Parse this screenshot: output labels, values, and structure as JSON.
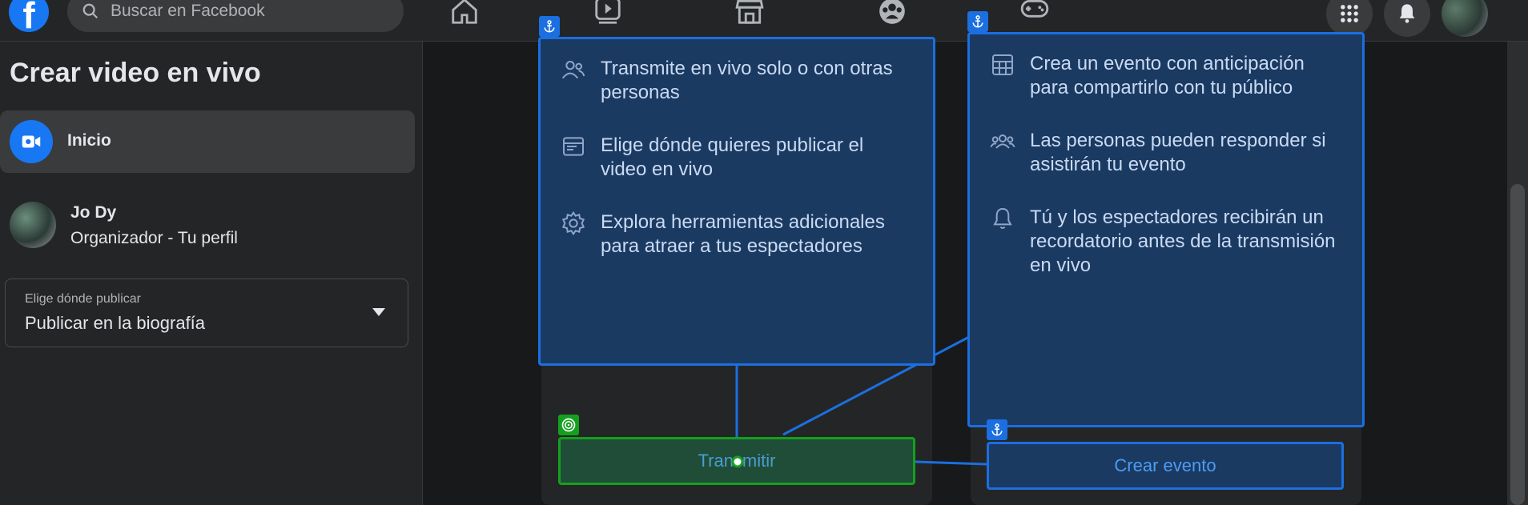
{
  "header": {
    "logo": "f",
    "search_placeholder": "Buscar en Facebook",
    "nav_icons": [
      "home-icon",
      "watch-icon",
      "marketplace-icon",
      "groups-icon",
      "gaming-icon"
    ],
    "right_icons": [
      "menu-grid-icon",
      "notifications-icon",
      "profile-avatar"
    ]
  },
  "sidebar": {
    "title": "Crear video en vivo",
    "item_label": "Inicio",
    "profile_name": "Jo Dy",
    "profile_sub": "Organizador - Tu perfil",
    "select_label": "Elige dónde publicar",
    "select_value": "Publicar en la biografía"
  },
  "live_card": {
    "features": [
      "Transmite en vivo solo o con otras personas",
      "Elige dónde quieres publicar el video en vivo",
      "Explora herramientas adicionales para atraer a tus espectadores"
    ],
    "button": "Transmitir"
  },
  "event_card": {
    "features": [
      "Crea un evento con anticipación para compartirlo con tu público",
      "Las personas pueden responder si asistirán tu evento",
      "Tú y los espectadores recibirán un recordatorio antes de la transmisión en vivo"
    ],
    "button": "Crear evento"
  },
  "colors": {
    "accent": "#1877f2",
    "panel_border": "#1b6fe0",
    "target_green": "#14a01e"
  }
}
